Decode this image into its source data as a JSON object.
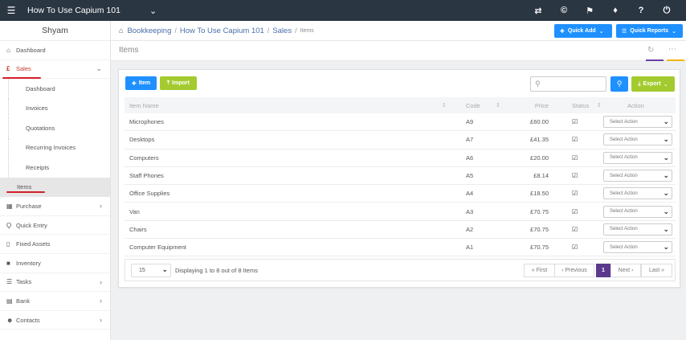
{
  "topbar": {
    "company": "How To Use Capium 101",
    "icons": [
      "menu-icon",
      "caret-down-icon",
      "exchange-icon",
      "copyright-icon",
      "bullhorn-icon",
      "tag-icon",
      "help-icon",
      "power-icon"
    ]
  },
  "sidebar": {
    "user": "Shyam",
    "items_top": [
      {
        "label": "Dashboard",
        "icon": "home-icon"
      },
      {
        "label": "Sales",
        "icon": "pound-icon"
      }
    ],
    "sales_sub": [
      "Dashboard",
      "Invoices",
      "Quotations",
      "Recurring Invoices",
      "Receipts",
      "Items"
    ],
    "items_bottom": [
      {
        "label": "Purchase",
        "icon": "cart-icon",
        "chevron": true
      },
      {
        "label": "Quick Entry",
        "icon": "bolt-icon",
        "chevron": false
      },
      {
        "label": "Fixed Assets",
        "icon": "building-icon",
        "chevron": false
      },
      {
        "label": "Inventory",
        "icon": "truck-icon",
        "chevron": false
      },
      {
        "label": "Tasks",
        "icon": "tasks-icon",
        "chevron": true
      },
      {
        "label": "Bank",
        "icon": "bank-icon",
        "chevron": true
      },
      {
        "label": "Contacts",
        "icon": "users-icon",
        "chevron": true
      }
    ]
  },
  "breadcrumb": {
    "items": [
      "Bookkeeping",
      "How To Use Capium 101",
      "Sales"
    ],
    "current": "Items",
    "quick_add": "Quick Add",
    "quick_reports": "Quick Reports"
  },
  "page": {
    "title": "Items"
  },
  "toolbar": {
    "item_btn": "Item",
    "import_btn": "Import",
    "search_placeholder": "",
    "export_btn": "Export"
  },
  "table": {
    "headers": {
      "name": "Item Name",
      "code": "Code",
      "price": "Price",
      "status": "Status",
      "action": "Action"
    },
    "select_label": "Select Action",
    "rows": [
      {
        "name": "Microphones",
        "code": "A9",
        "price": "£60.00"
      },
      {
        "name": "Desktops",
        "code": "A7",
        "price": "£41.35"
      },
      {
        "name": "Computers",
        "code": "A6",
        "price": "£20.00"
      },
      {
        "name": "Staff Phones",
        "code": "A5",
        "price": "£8.14"
      },
      {
        "name": "Office Supplies",
        "code": "A4",
        "price": "£18.50"
      },
      {
        "name": "Van",
        "code": "A3",
        "price": "£70.75"
      },
      {
        "name": "Chairs",
        "code": "A2",
        "price": "£70.75"
      },
      {
        "name": "Computer Equipment",
        "code": "A1",
        "price": "£70.75"
      }
    ]
  },
  "pager": {
    "page_size": "15",
    "display_text": "Displaying 1 to 8 out of 8 Items",
    "first": "« First",
    "previous": "‹ Previous",
    "current_page": "1",
    "next": "Next ›",
    "last": "Last »"
  },
  "colors": {
    "topbar": "#2b3643",
    "accent_blue": "#1e90ff",
    "accent_green": "#a3cb2f",
    "active_page": "#5b3a8e",
    "highlight_red": "#d3202a"
  }
}
